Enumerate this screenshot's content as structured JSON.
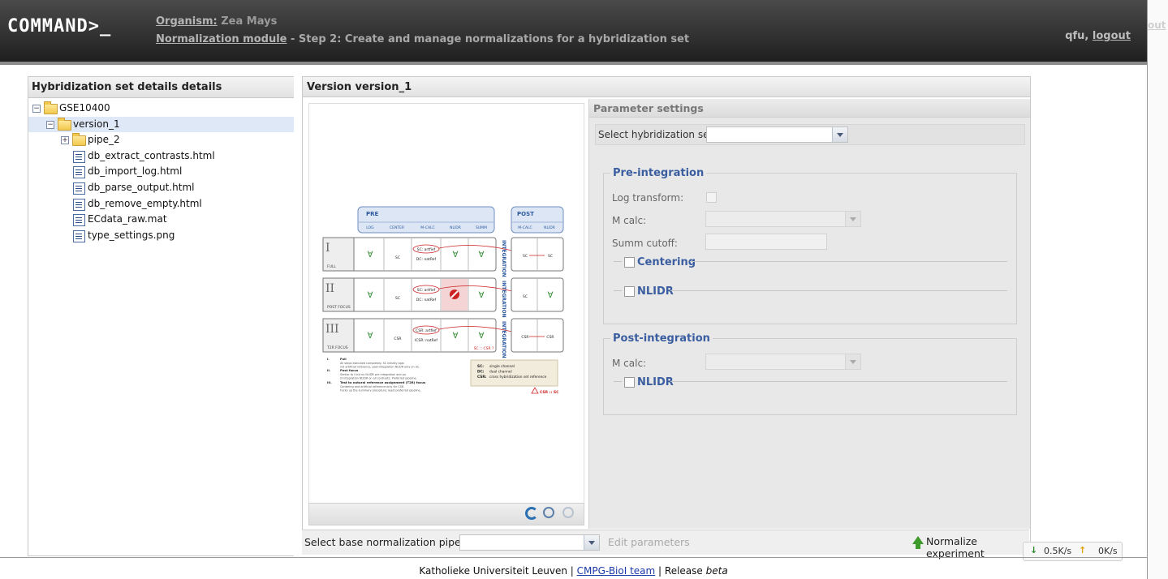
{
  "header": {
    "logo": "COMMAND>_",
    "organism_link": "Organism:",
    "organism_value": " Zea Mays",
    "module_link": "Normalization module",
    "step_text": " - Step 2: Create and manage normalizations for a hybridization set",
    "user": "qfu,",
    "logout": "logout",
    "edge_text": "out"
  },
  "left_panel": {
    "title": "Hybridization set details details",
    "tree": [
      {
        "label": "GSE10400",
        "type": "folder",
        "expanded": true,
        "level": 0
      },
      {
        "label": "version_1",
        "type": "folder",
        "expanded": true,
        "level": 1,
        "selected": true
      },
      {
        "label": "pipe_2",
        "type": "folder",
        "expanded": false,
        "level": 2
      },
      {
        "label": "db_extract_contrasts.html",
        "type": "file",
        "level": 2
      },
      {
        "label": "db_import_log.html",
        "type": "file",
        "level": 2
      },
      {
        "label": "db_parse_output.html",
        "type": "file",
        "level": 2
      },
      {
        "label": "db_remove_empty.html",
        "type": "file",
        "level": 2
      },
      {
        "label": "ECdata_raw.mat",
        "type": "file",
        "level": 2
      },
      {
        "label": "type_settings.png",
        "type": "file",
        "level": 2
      }
    ]
  },
  "main_panel": {
    "title": "Version version_1",
    "diagram": {
      "pre_label": "PRE",
      "post_label": "POST",
      "pre_cols": [
        "LOG",
        "CENTER",
        "M-CALC",
        "NLIDR",
        "SUMM"
      ],
      "post_cols": [
        "M-CALC",
        "NLIDR"
      ],
      "integration": "INTEGRATION",
      "rows": [
        {
          "roman": "I",
          "name": "FULL",
          "artef": "SC: artfief",
          "natref": "DC: natRef",
          "sc": "SC",
          "post1": "SC",
          "post2": "SC"
        },
        {
          "roman": "II",
          "name": "POST FOCUS",
          "artef": "SC: artfief",
          "natref": "DC: natRef",
          "sc": "SC",
          "post1": "SC",
          "post2": ""
        },
        {
          "roman": "III",
          "name": "T2R FOCUS",
          "artef": "CSR: artfief",
          "natref": "ICSR: natRef",
          "sc": "CSR",
          "post1": "CSR",
          "post2": "CSR"
        }
      ],
      "sc_note": "SC :: CSR ?",
      "notes": [
        {
          "num": "I.",
          "head": "Full",
          "text": "All steps executed completely. SC initially against artificial reference, post-integration NLIDR only on SC."
        },
        {
          "num": "II.",
          "head": "Post focus",
          "text": "Similar to I but no NLIDR pre integration and post integration NLIDR on all contrasts. Preferred pipeline."
        },
        {
          "num": "III.",
          "head": "Test to natural reference assignment (T2R) focus",
          "text": "Centering and artificial reference only for CSR. Fucks up the summary procedure; least preferred pipeline."
        }
      ],
      "legend": [
        {
          "key": "SC:",
          "val": "single channel"
        },
        {
          "key": "DC:",
          "val": "dual channel"
        },
        {
          "key": "CSR:",
          "val": "cross hybridization set reference"
        }
      ],
      "warn": "CSR :: SC"
    },
    "params": {
      "title": "Parameter settings",
      "select_hyb_label": "Select hybridization set:",
      "pre_integration": {
        "legend": "Pre-integration",
        "log_transform": "Log transform:",
        "m_calc": "M calc:",
        "summ_cutoff": "Summ cutoff:",
        "centering": "Centering",
        "nlidr": "NLIDR"
      },
      "post_integration": {
        "legend": "Post-integration",
        "m_calc": "M calc:",
        "nlidr": "NLIDR"
      }
    },
    "bottom": {
      "select_pipeline": "Select base normalization pipeline:",
      "edit_params": "Edit parameters",
      "normalize": "Normalize experiment"
    }
  },
  "netspeed": {
    "down": "0.5K/s",
    "up": "0K/s"
  },
  "footer": {
    "university": "Katholieke Universiteit Leuven",
    "team": "CMPG-BioI team",
    "release": "Release",
    "release_value": "beta"
  },
  "colors": {
    "header_bg": "#2c2c2c",
    "selected_row": "#dfe8f6",
    "legend_blue": "#3a5ea0",
    "diagram_blue": "#2e5aa0",
    "green_check": "#2e8b2e",
    "red": "#cc2222"
  }
}
